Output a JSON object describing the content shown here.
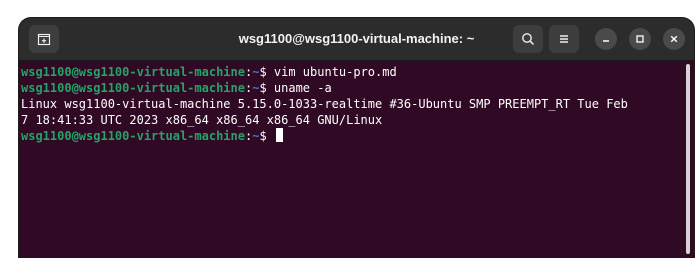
{
  "window": {
    "title": "wsg1100@wsg1100-virtual-machine: ~",
    "background": "#300a24",
    "titlebar_background": "#2c2c2c"
  },
  "titlebar": {
    "new_tab_icon": "new-tab-icon",
    "search_icon": "search-icon",
    "menu_icon": "hamburger-menu-icon",
    "minimize_icon": "minimize-icon",
    "maximize_icon": "maximize-icon",
    "close_icon": "close-icon"
  },
  "terminal": {
    "lines": [
      {
        "type": "prompt",
        "user_host": "wsg1100@wsg1100-virtual-machine",
        "colon": ":",
        "path": "~",
        "symbol": "$ ",
        "command": "vim ubuntu-pro.md"
      },
      {
        "type": "prompt",
        "user_host": "wsg1100@wsg1100-virtual-machine",
        "colon": ":",
        "path": "~",
        "symbol": "$ ",
        "command": "uname -a"
      },
      {
        "type": "output",
        "text": "Linux wsg1100-virtual-machine 5.15.0-1033-realtime #36-Ubuntu SMP PREEMPT_RT Tue Feb"
      },
      {
        "type": "output",
        "text": "7 18:41:33 UTC 2023 x86_64 x86_64 x86_64 GNU/Linux"
      },
      {
        "type": "prompt",
        "user_host": "wsg1100@wsg1100-virtual-machine",
        "colon": ":",
        "path": "~",
        "symbol": "$ ",
        "command": ""
      }
    ],
    "colors": {
      "user_host": "#26a269",
      "path": "#3a78d6",
      "text": "#ffffff"
    }
  }
}
